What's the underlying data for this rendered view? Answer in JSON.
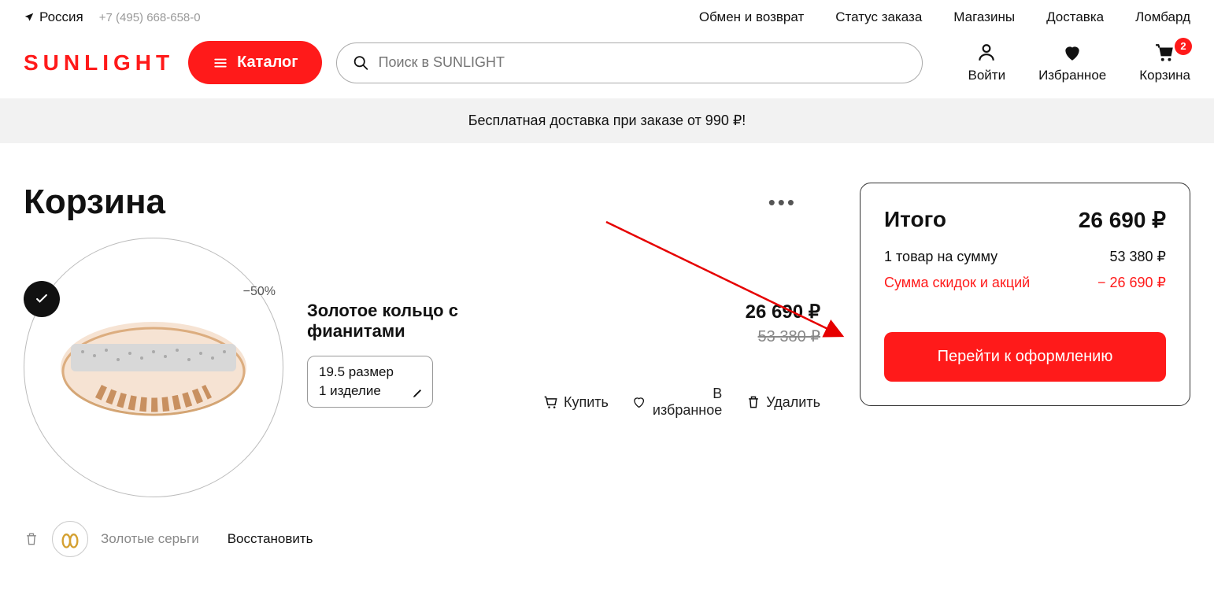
{
  "topbar": {
    "location": "Россия",
    "phone": "+7 (495) 668-658-0",
    "links": [
      "Обмен и возврат",
      "Статус заказа",
      "Магазины",
      "Доставка",
      "Ломбард"
    ]
  },
  "header": {
    "logo": "SUNLIGHT",
    "catalog": "Каталог",
    "search_placeholder": "Поиск в SUNLIGHT",
    "login": "Войти",
    "favorites": "Избранное",
    "cart": "Корзина",
    "cart_count": "2"
  },
  "banner": "Бесплатная доставка при заказе от 990 ₽!",
  "cart": {
    "title": "Корзина",
    "item": {
      "name": "Золотое кольцо с фианитами",
      "discount_badge": "−50%",
      "size": "19.5 размер",
      "qty": "1 изделие",
      "price": "26 690 ₽",
      "old_price": "53 380 ₽",
      "buy": "Купить",
      "fav": "В избранное",
      "del": "Удалить"
    },
    "removed": {
      "name": "Золотые серьги",
      "restore": "Восстановить"
    }
  },
  "summary": {
    "total_label": "Итого",
    "total_value": "26 690 ₽",
    "items_label": "1 товар на сумму",
    "items_value": "53 380 ₽",
    "discount_label": "Сумма скидок и акций",
    "discount_value": "− 26 690 ₽",
    "checkout": "Перейти к оформлению"
  }
}
